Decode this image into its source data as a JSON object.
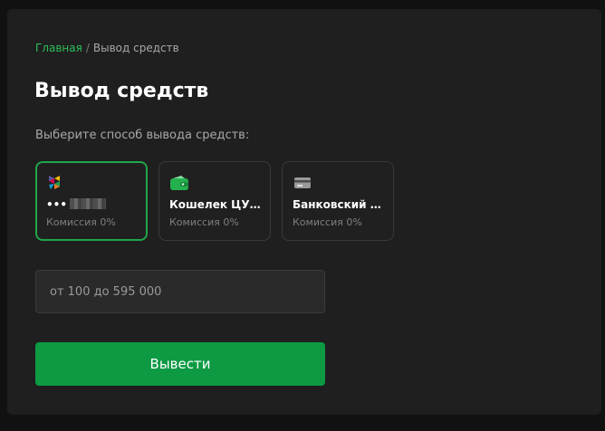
{
  "breadcrumb": {
    "home": "Главная",
    "separator": "/",
    "current": "Вывод средств"
  },
  "title": "Вывод средств",
  "subtitle": "Выберите способ вывода средств:",
  "methods": [
    {
      "name": "•••",
      "fee": "Комиссия 0%",
      "icon": "sbp-logo-icon",
      "selected": true
    },
    {
      "name": "Кошелек ЦУПИС",
      "fee": "Комиссия 0%",
      "icon": "wallet-icon",
      "selected": false
    },
    {
      "name": "Банковский перевод",
      "fee": "Комиссия 0%",
      "icon": "bank-card-icon",
      "selected": false
    }
  ],
  "amount": {
    "value": "",
    "placeholder": "от 100 до 595 000"
  },
  "submit_label": "Вывести",
  "colors": {
    "accent": "#0d9a43",
    "selected_border": "#1fa64a",
    "breadcrumb_link": "#2dbf5a",
    "background": "#1f1f1f"
  }
}
